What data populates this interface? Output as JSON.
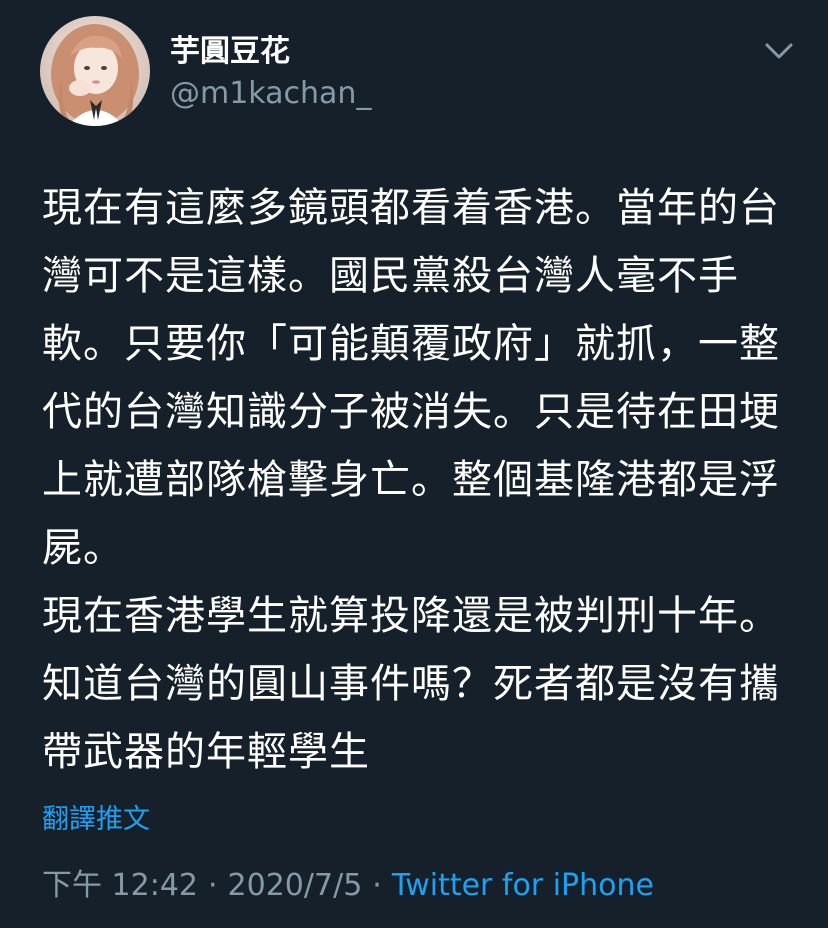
{
  "author": {
    "display_name": "芋圓豆花",
    "handle": "@m1kachan_",
    "avatar_icon": "profile-photo"
  },
  "menu": {
    "icon": "chevron-down-icon"
  },
  "tweet": {
    "text": "現在有這麼多鏡頭都看着香港。當年的台灣可不是這樣。國民黨殺台灣人毫不手軟。只要你「可能顛覆政府」就抓，一整代的台灣知識分子被消失。只是待在田埂上就遭部隊槍擊身亡。整個基隆港都是浮屍。\n現在香港學生就算投降還是被判刑十年。知道台灣的圓山事件嗎？死者都是沒有攜帶武器的年輕學生",
    "translate_label": "翻譯推文"
  },
  "meta": {
    "time": "下午 12:42",
    "separator": "·",
    "date": "2020/7/5",
    "source": "Twitter for iPhone"
  },
  "colors": {
    "background": "#15202b",
    "text": "#ffffff",
    "secondary": "#8899a6",
    "accent": "#1da1f2"
  }
}
